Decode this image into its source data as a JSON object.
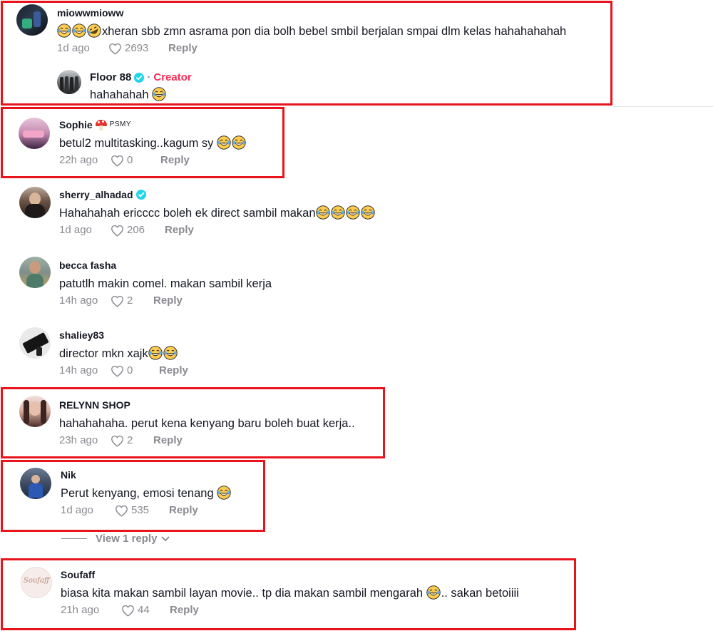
{
  "colors": {
    "highlight_box": "#e8141b",
    "creator": "#fe2c55",
    "verified": "#20d5ec",
    "meta": "#8a8b91"
  },
  "icons": {
    "like": "heart-outline-icon",
    "verified": "verified-badge-icon",
    "emoji": "face-with-tears-of-joy-emoji",
    "emoji_alt": "rolling-on-floor-laughing-emoji",
    "mushroom": "mushroom-emoji",
    "chevron": "chevron-down-icon"
  },
  "comments": [
    {
      "username": "miowwmioww",
      "text": "xheran sbb zmn asrama pon dia bolh bebel smbil berjalan smpai dlm kelas hahahahahah",
      "time": "1d ago",
      "likes": "2693",
      "reply": "Reply",
      "reply_item": {
        "username": "Floor 88",
        "separator": "·",
        "badge": "Creator",
        "text": "hahahahah"
      }
    },
    {
      "username": "Sophie",
      "tag": "PSMY",
      "text": "betul2 multitasking..kagum sy",
      "time": "22h ago",
      "likes": "0",
      "reply": "Reply"
    },
    {
      "username": "sherry_alhadad",
      "text": "Hahahahah ericccc boleh ek direct sambil makan",
      "time": "1d ago",
      "likes": "206",
      "reply": "Reply"
    },
    {
      "username": "becca fasha",
      "text": "patutlh makin comel. makan sambil kerja",
      "time": "14h ago",
      "likes": "2",
      "reply": "Reply"
    },
    {
      "username": "shaliey83",
      "text": "director mkn xajk",
      "time": "14h ago",
      "likes": "0",
      "reply": "Reply"
    },
    {
      "username": "RELYNN SHOP",
      "text": "hahahahaha. perut kena kenyang baru boleh buat kerja..",
      "time": "23h ago",
      "likes": "2",
      "reply": "Reply"
    },
    {
      "username": "Nik",
      "text": "Perut kenyang, emosi tenang",
      "time": "1d ago",
      "likes": "535",
      "reply": "Reply"
    },
    {
      "username": "Soufaff",
      "avatar_text": "Soufaff",
      "text": "biasa kita makan sambil layan movie.. tp dia makan sambil mengarah",
      "text_after": ".. sakan betoiiii",
      "time": "21h ago",
      "likes": "44",
      "reply": "Reply"
    }
  ],
  "view_replies": "View 1 reply"
}
